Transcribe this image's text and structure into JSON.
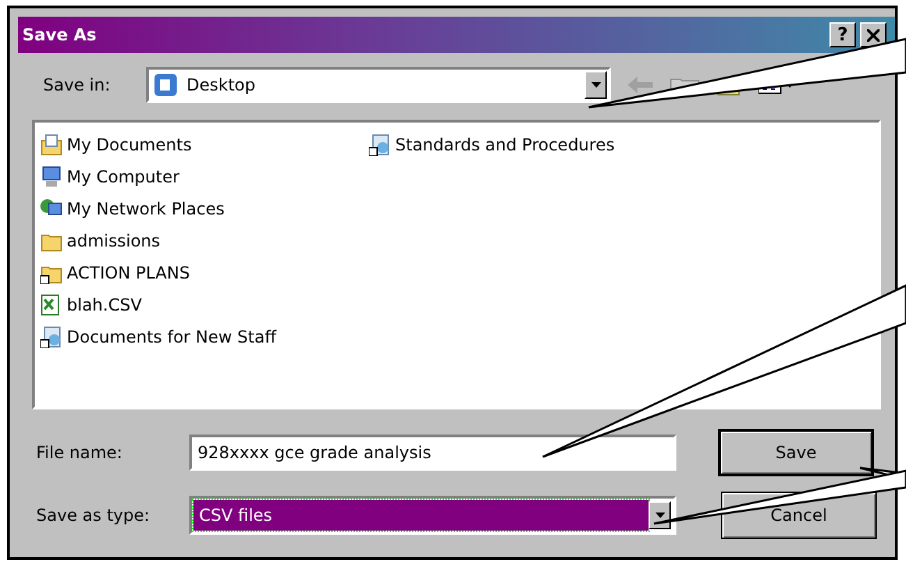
{
  "window": {
    "title": "Save As",
    "help_button": "?"
  },
  "save_in": {
    "label": "Save in:",
    "value": "Desktop"
  },
  "files": [
    {
      "name": "My Documents",
      "kind": "documents"
    },
    {
      "name": "My Computer",
      "kind": "computer"
    },
    {
      "name": "My Network Places",
      "kind": "network"
    },
    {
      "name": "admissions",
      "kind": "folder"
    },
    {
      "name": "ACTION PLANS",
      "kind": "folder-shortcut"
    },
    {
      "name": "blah.CSV",
      "kind": "csv"
    },
    {
      "name": "Documents for New Staff",
      "kind": "shortcut"
    },
    {
      "name": "Standards and Procedures",
      "kind": "shortcut"
    }
  ],
  "file_name": {
    "label": "File name:",
    "value": "928xxxx gce grade analysis"
  },
  "save_as_type": {
    "label": "Save as type:",
    "value": "CSV files",
    "selected": true
  },
  "buttons": [
    {
      "label": "Save",
      "default": true
    },
    {
      "label": "Cancel",
      "default": false
    }
  ]
}
